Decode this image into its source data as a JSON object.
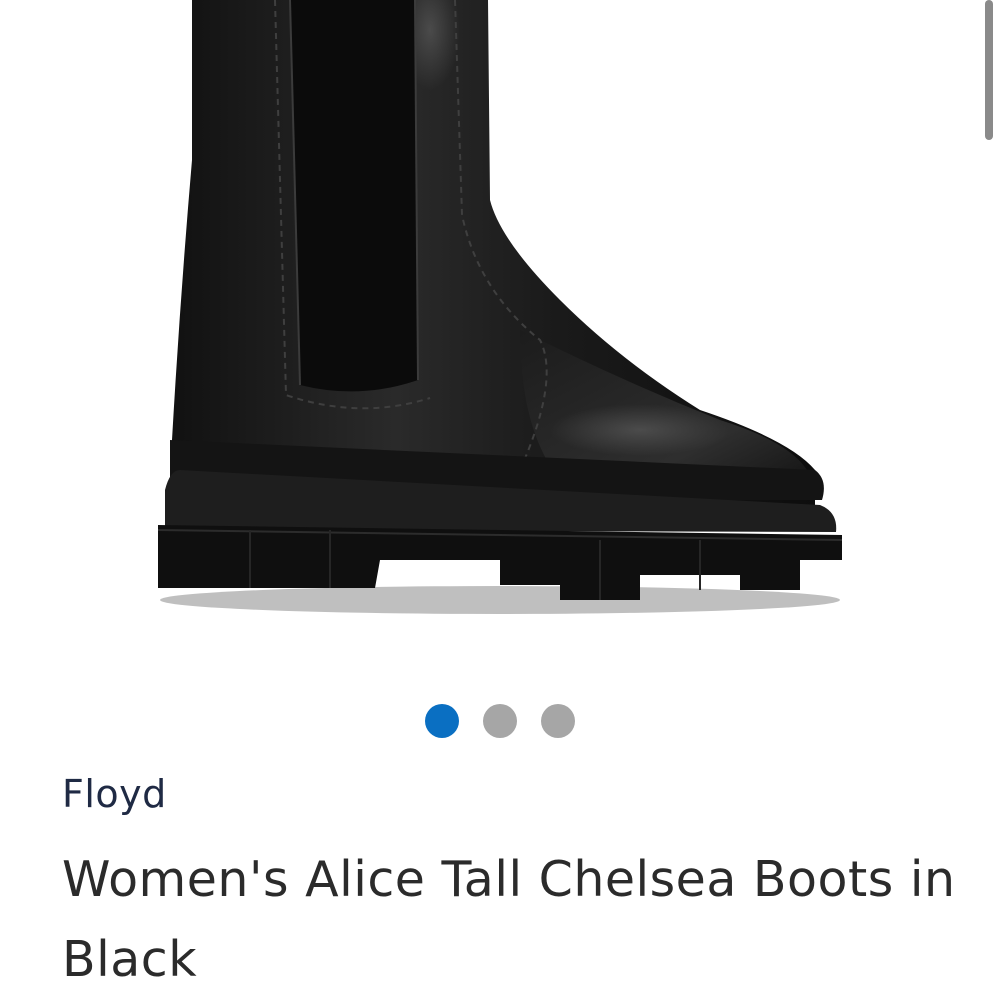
{
  "product": {
    "brand": "Floyd",
    "title": "Women's Alice Tall Chelsea Boots in Black"
  },
  "gallery": {
    "image_alt": "Women's Alice Tall Chelsea Boots in Black",
    "dots": [
      {
        "active": true,
        "color": "#0a6fc2"
      },
      {
        "active": false,
        "color": "#a6a6a6"
      },
      {
        "active": false,
        "color": "#a6a6a6"
      }
    ],
    "active_index": 0
  },
  "colors": {
    "accent": "#0a6fc2",
    "inactive_dot": "#a6a6a6",
    "brand_text": "#1f2a44",
    "title_text": "#2b2b2b"
  }
}
